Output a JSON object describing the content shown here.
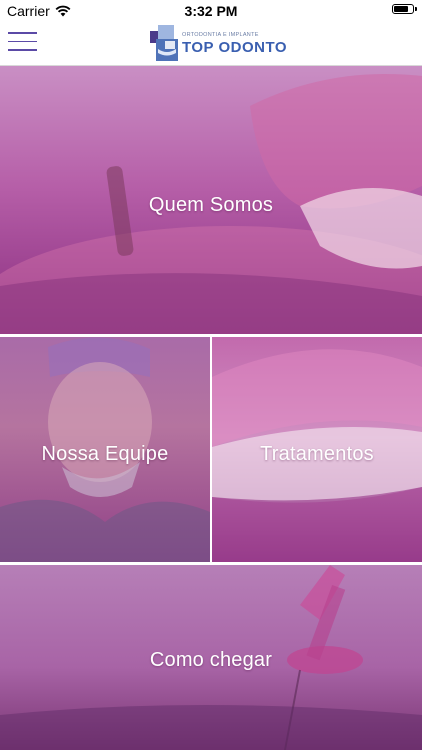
{
  "status_bar": {
    "carrier": "Carrier",
    "time": "3:32 PM",
    "battery_level": 0.85
  },
  "header": {
    "logo_subtitle": "ORTODONTIA E IMPLANTE",
    "logo_title": "TOP ODONTO"
  },
  "tiles": [
    {
      "label": "Quem Somos"
    },
    {
      "label": "Nossa Equipe"
    },
    {
      "label": "Tratamentos"
    },
    {
      "label": "Como chegar"
    }
  ],
  "colors": {
    "menu_icon": "#5b4aa6",
    "logo_blue": "#3a5fb0",
    "overlay_magenta": "#b0469f"
  }
}
